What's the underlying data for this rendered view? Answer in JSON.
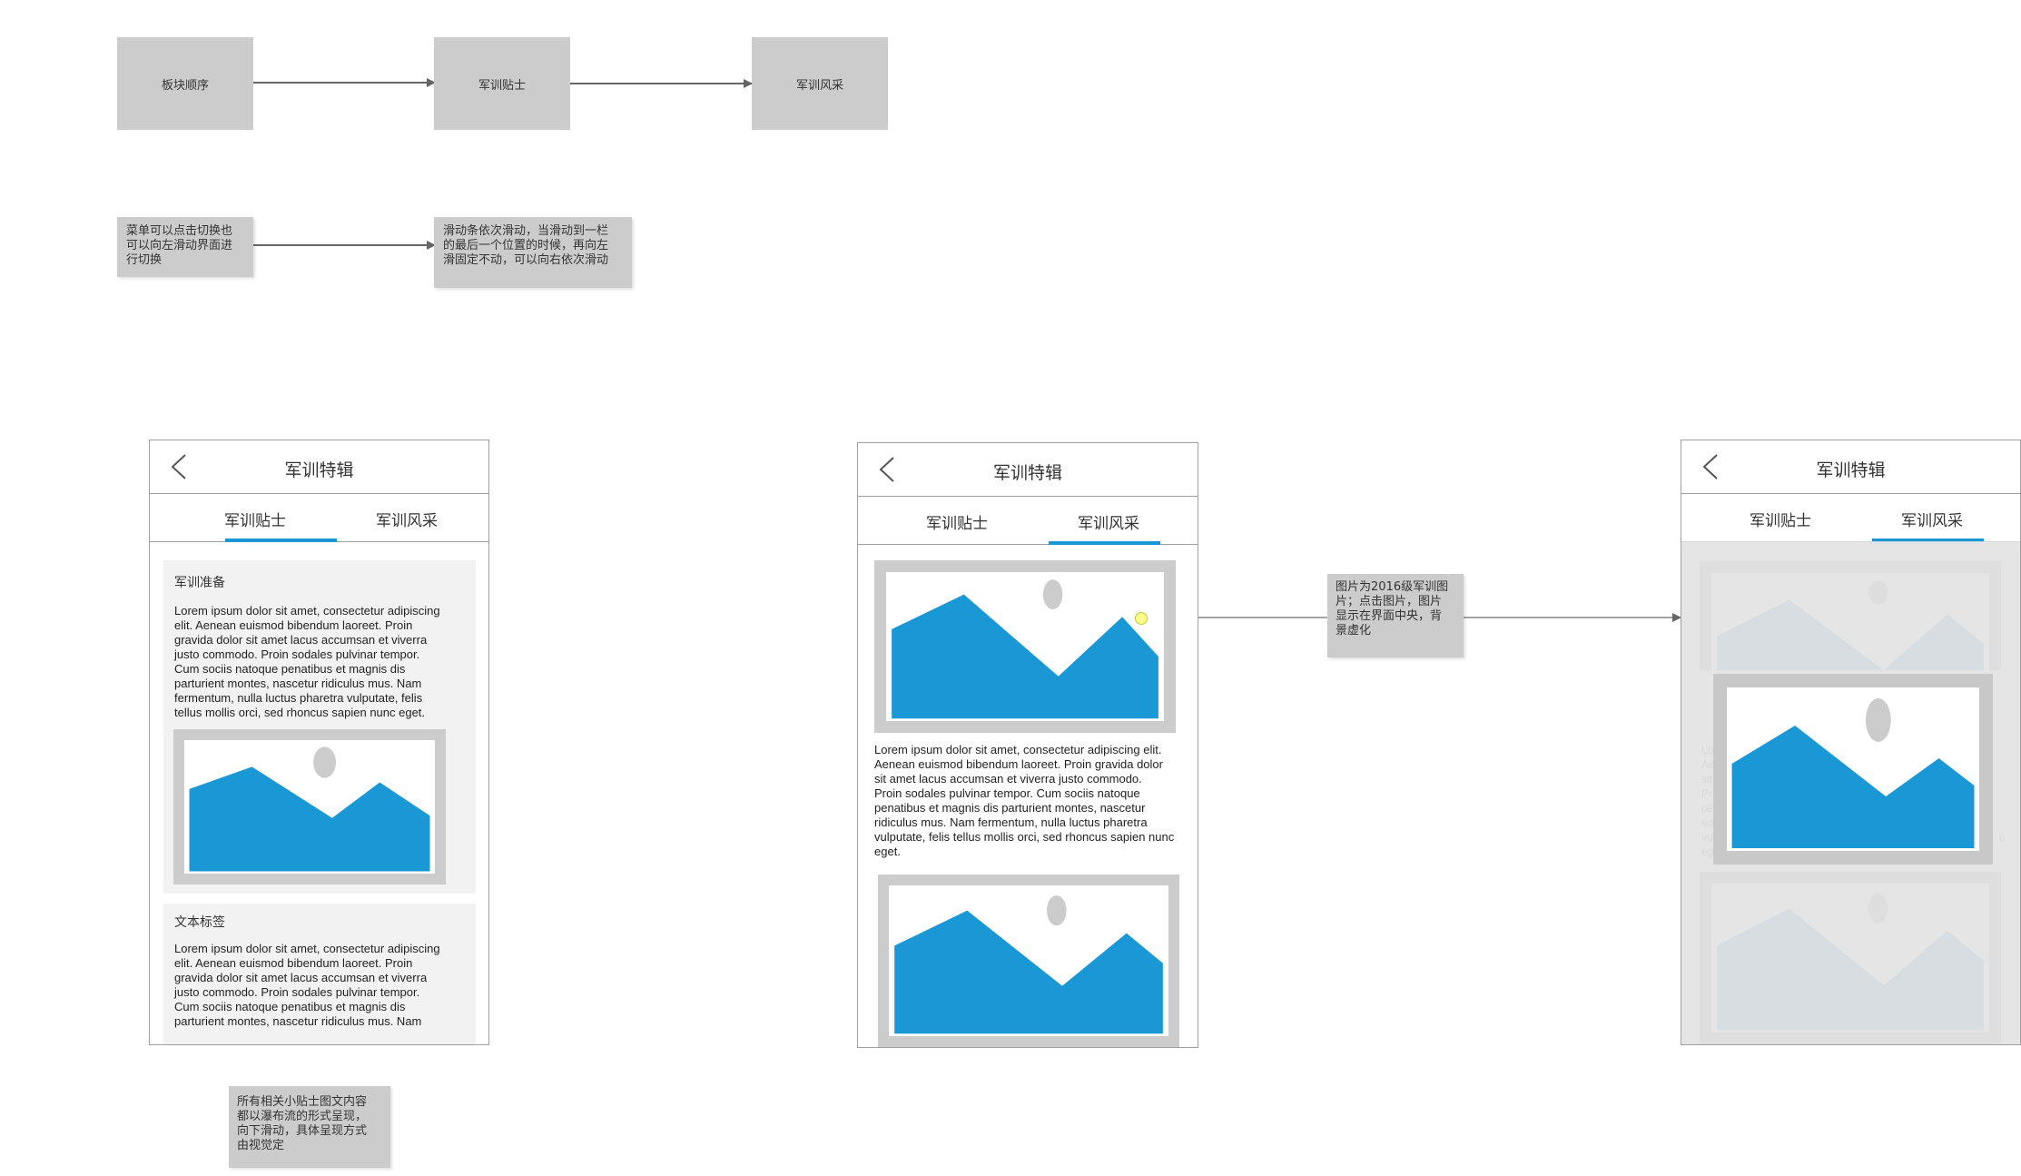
{
  "flow_top": {
    "step1": "板块顺序",
    "step2": "军训贴士",
    "step3": "军训风采"
  },
  "flow_notes": {
    "menu_switch": [
      "菜单可以点击切换也",
      "可以向左滑动界面进",
      "行切换"
    ],
    "slide_rule": [
      "滑动条依次滑动，当滑动到一栏",
      "的最后一个位置的时候，再向左",
      "滑固定不动，可以向右依次滑动"
    ]
  },
  "screen_common": {
    "title": "军训特辑",
    "tab1": "军训贴士",
    "tab2": "军训风采"
  },
  "screen1": {
    "card1_title": "军训准备",
    "card1_lines": [
      "Lorem ipsum dolor sit amet, consectetur adipiscing",
      "elit. Aenean euismod bibendum laoreet. Proin",
      "gravida dolor sit amet lacus accumsan et viverra",
      "justo commodo. Proin sodales pulvinar tempor.",
      "Cum sociis natoque penatibus et magnis dis",
      "parturient montes, nascetur ridiculus mus. Nam",
      "fermentum, nulla luctus pharetra vulputate, felis",
      "tellus mollis orci, sed rhoncus sapien nunc eget."
    ],
    "card2_title": "文本标签",
    "card2_lines": [
      "Lorem ipsum dolor sit amet, consectetur adipiscing",
      "elit. Aenean euismod bibendum laoreet. Proin",
      "gravida dolor sit amet lacus accumsan et viverra",
      "justo commodo. Proin sodales pulvinar tempor.",
      "Cum sociis natoque penatibus et magnis dis",
      "parturient montes, nascetur ridiculus mus. Nam"
    ]
  },
  "screen2": {
    "body_lines": [
      "Lorem ipsum dolor sit amet, consectetur adipiscing elit.",
      "Aenean euismod bibendum laoreet. Proin gravida dolor",
      "sit amet lacus accumsan et viverra justo commodo.",
      "Proin sodales pulvinar tempor. Cum sociis natoque",
      "penatibus et magnis dis parturient montes, nascetur",
      "ridiculus mus. Nam fermentum, nulla luctus pharetra",
      "vulputate, felis tellus mollis orci, sed rhoncus sapien nunc",
      "eget."
    ]
  },
  "screen3": {
    "faded_left_chars": [
      "Lo",
      "Ae",
      "sit",
      "Pr",
      "pe",
      "rid",
      "vu",
      "eg"
    ],
    "faded_right_char": "c"
  },
  "annotations": {
    "image_note": [
      "图片为2016级军训图",
      "片；点击图片，图片",
      "显示在界面中央，背",
      "景虚化"
    ],
    "tips_note": [
      "所有相关小贴士图文内容",
      "都以瀑布流的形式呈现，",
      "向下滑动，具体呈现方式",
      "由视觉定"
    ]
  },
  "colors": {
    "placeholder_gray": "#cccccc",
    "accent_blue": "#1a98d5",
    "faded_blue": "#a2c8db",
    "marker_yellow": "#ffff88"
  }
}
